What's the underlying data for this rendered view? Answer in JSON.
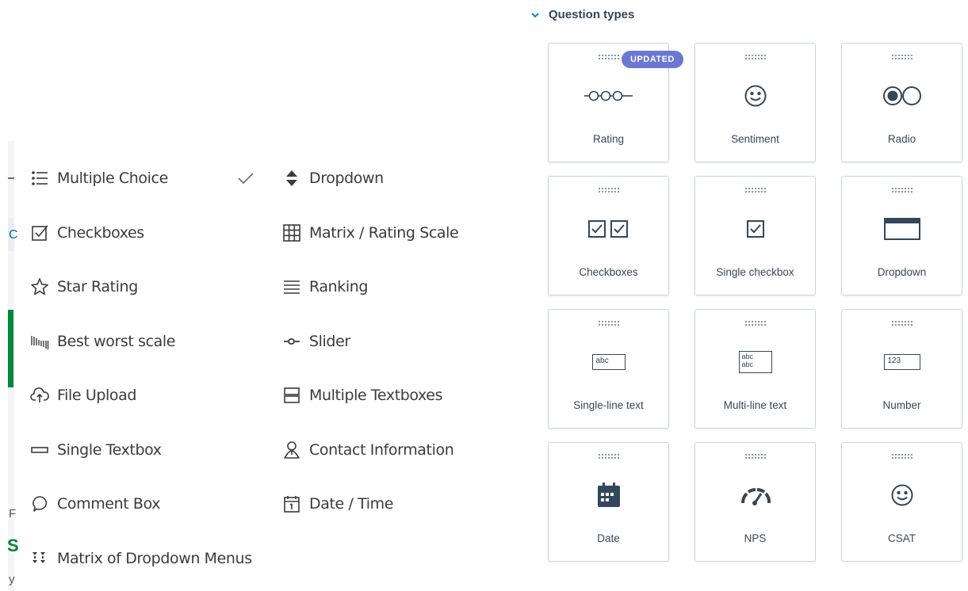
{
  "left_panel": {
    "items": [
      {
        "label": "Multiple Choice",
        "icon": "list-icon",
        "selected": true
      },
      {
        "label": "Checkboxes",
        "icon": "checkbox-icon"
      },
      {
        "label": "Star Rating",
        "icon": "star-icon"
      },
      {
        "label": "Best worst scale",
        "icon": "best-worst-scale-icon"
      },
      {
        "label": "File Upload",
        "icon": "cloud-upload-icon"
      },
      {
        "label": "Single Textbox",
        "icon": "textbox-icon"
      },
      {
        "label": "Comment Box",
        "icon": "speech-bubble-icon"
      },
      {
        "label": "Matrix of Dropdown Menus",
        "icon": "matrix-dropdown-icon"
      },
      {
        "label": "Dropdown",
        "icon": "dropdown-arrows-icon"
      },
      {
        "label": "Matrix / Rating Scale",
        "icon": "grid-icon"
      },
      {
        "label": "Ranking",
        "icon": "ranking-lines-icon"
      },
      {
        "label": "Slider",
        "icon": "slider-icon"
      },
      {
        "label": "Multiple Textboxes",
        "icon": "multiple-textboxes-icon"
      },
      {
        "label": "Contact Information",
        "icon": "person-icon"
      },
      {
        "label": "Date / Time",
        "icon": "calendar-icon"
      }
    ]
  },
  "edge_fragments": {
    "c": "C",
    "f": "F",
    "s": "S",
    "y": "y"
  },
  "right_panel": {
    "section_title": "Question types",
    "cards": [
      {
        "label": "Rating",
        "icon": "rating-scale-icon",
        "badge": "UPDATED"
      },
      {
        "label": "Sentiment",
        "icon": "smiley-icon"
      },
      {
        "label": "Radio",
        "icon": "radio-icon"
      },
      {
        "label": "Checkboxes",
        "icon": "double-checkbox-icon"
      },
      {
        "label": "Single checkbox",
        "icon": "single-checkbox-icon"
      },
      {
        "label": "Dropdown",
        "icon": "dropdown-box-icon"
      },
      {
        "label": "Single-line text",
        "icon": "text-input-icon",
        "icon_text": "abc"
      },
      {
        "label": "Multi-line text",
        "icon": "text-area-icon",
        "icon_text_1": "abc",
        "icon_text_2": "abc"
      },
      {
        "label": "Number",
        "icon": "number-input-icon",
        "icon_text": "123"
      },
      {
        "label": "Date",
        "icon": "calendar-icon"
      },
      {
        "label": "NPS",
        "icon": "gauge-icon"
      },
      {
        "label": "CSAT",
        "icon": "smiley-icon"
      }
    ]
  },
  "colors": {
    "badge": "#6a78d1",
    "text": "#33475b",
    "border": "#cbd6e2",
    "edge_green": "#00873c"
  }
}
